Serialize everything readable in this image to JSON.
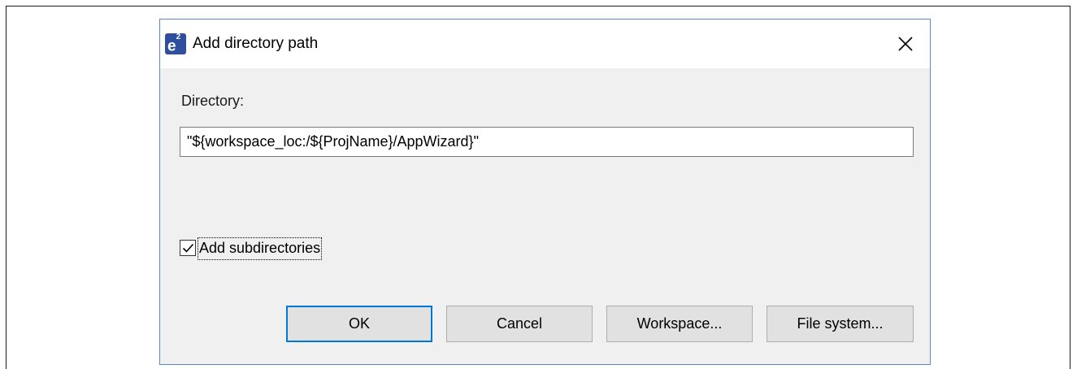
{
  "dialog": {
    "app_icon_text": "e",
    "app_icon_sup": "2",
    "title": "Add directory path",
    "close_icon": "close-icon"
  },
  "form": {
    "directory_label": "Directory:",
    "directory_value": "\"${workspace_loc:/${ProjName}/AppWizard}\"",
    "add_subdirectories_label": "Add subdirectories",
    "add_subdirectories_checked": true
  },
  "buttons": {
    "ok": "OK",
    "cancel": "Cancel",
    "workspace": "Workspace...",
    "file_system": "File system..."
  },
  "colors": {
    "accent": "#0078d7",
    "dialog_border": "#5f87c8",
    "app_icon_bg": "#2f4f9e"
  }
}
